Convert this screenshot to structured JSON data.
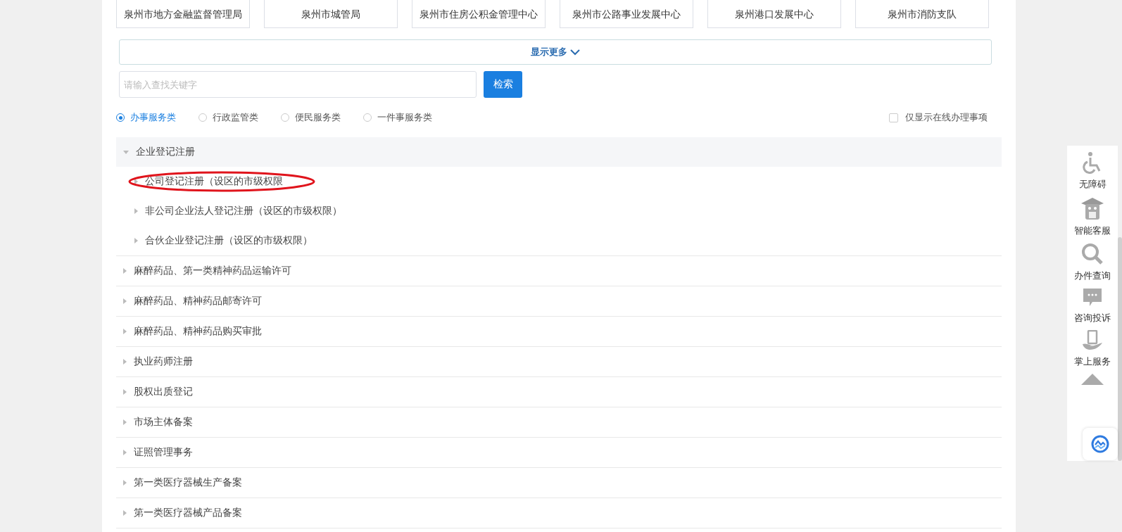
{
  "departments": [
    "泉州市地方金融监督管理局",
    "泉州市城管局",
    "泉州市住房公积金管理中心",
    "泉州市公路事业发展中心",
    "泉州港口发展中心",
    "泉州市消防支队"
  ],
  "show_more": "显示更多",
  "search": {
    "placeholder": "请输入查找关键字",
    "button": "检索"
  },
  "categories": [
    {
      "label": "办事服务类",
      "selected": true
    },
    {
      "label": "行政监管类",
      "selected": false
    },
    {
      "label": "便民服务类",
      "selected": false
    },
    {
      "label": "一件事服务类",
      "selected": false
    }
  ],
  "online_only": {
    "label": "仅显示在线办理事项",
    "checked": false
  },
  "tree": [
    {
      "label": "企业登记注册",
      "expanded": true,
      "children": [
        {
          "label": "公司登记注册（设区的市级权限",
          "circled": true
        },
        {
          "label": "非公司企业法人登记注册（设区的市级权限）",
          "circled": false
        },
        {
          "label": "合伙企业登记注册（设区的市级权限）",
          "circled": false
        }
      ]
    },
    {
      "label": "麻醉药品、第一类精神药品运输许可",
      "expanded": false
    },
    {
      "label": "麻醉药品、精神药品邮寄许可",
      "expanded": false
    },
    {
      "label": "麻醉药品、精神药品购买审批",
      "expanded": false
    },
    {
      "label": "执业药师注册",
      "expanded": false
    },
    {
      "label": "股权出质登记",
      "expanded": false
    },
    {
      "label": "市场主体备案",
      "expanded": false
    },
    {
      "label": "证照管理事务",
      "expanded": false
    },
    {
      "label": "第一类医疗器械生产备案",
      "expanded": false
    },
    {
      "label": "第一类医疗器械产品备案",
      "expanded": false
    }
  ],
  "side_tools": [
    {
      "kind": "accessibility",
      "label": "无障碍"
    },
    {
      "kind": "robot",
      "label": "智能客服"
    },
    {
      "kind": "search",
      "label": "办件查询"
    },
    {
      "kind": "chat",
      "label": "咨询投诉"
    },
    {
      "kind": "phone",
      "label": "掌上服务"
    },
    {
      "kind": "top"
    }
  ]
}
